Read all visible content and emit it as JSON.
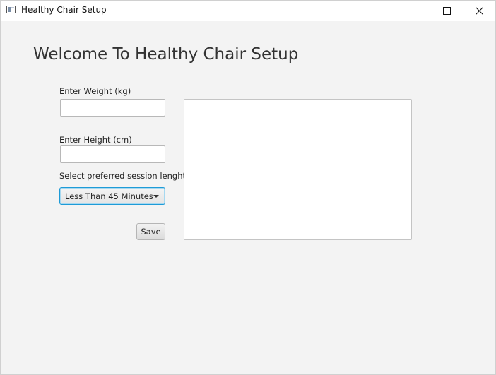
{
  "window": {
    "title": "Healthy Chair Setup",
    "app_icon": "app-window-icon",
    "controls": {
      "minimize_icon": "minimize-icon",
      "maximize_icon": "maximize-icon",
      "close_icon": "close-icon"
    }
  },
  "main": {
    "heading": "Welcome To Healthy Chair Setup",
    "weight": {
      "label": "Enter Weight (kg)",
      "value": "",
      "placeholder": ""
    },
    "height": {
      "label": "Enter Height (cm)",
      "value": "",
      "placeholder": ""
    },
    "session": {
      "label": "Select preferred session lenght",
      "selected": "Less Than 45 Minutes"
    },
    "save_label": "Save",
    "output": {
      "value": ""
    }
  },
  "colors": {
    "background": "#f3f3f3",
    "focus_border": "#1e9bd7"
  }
}
